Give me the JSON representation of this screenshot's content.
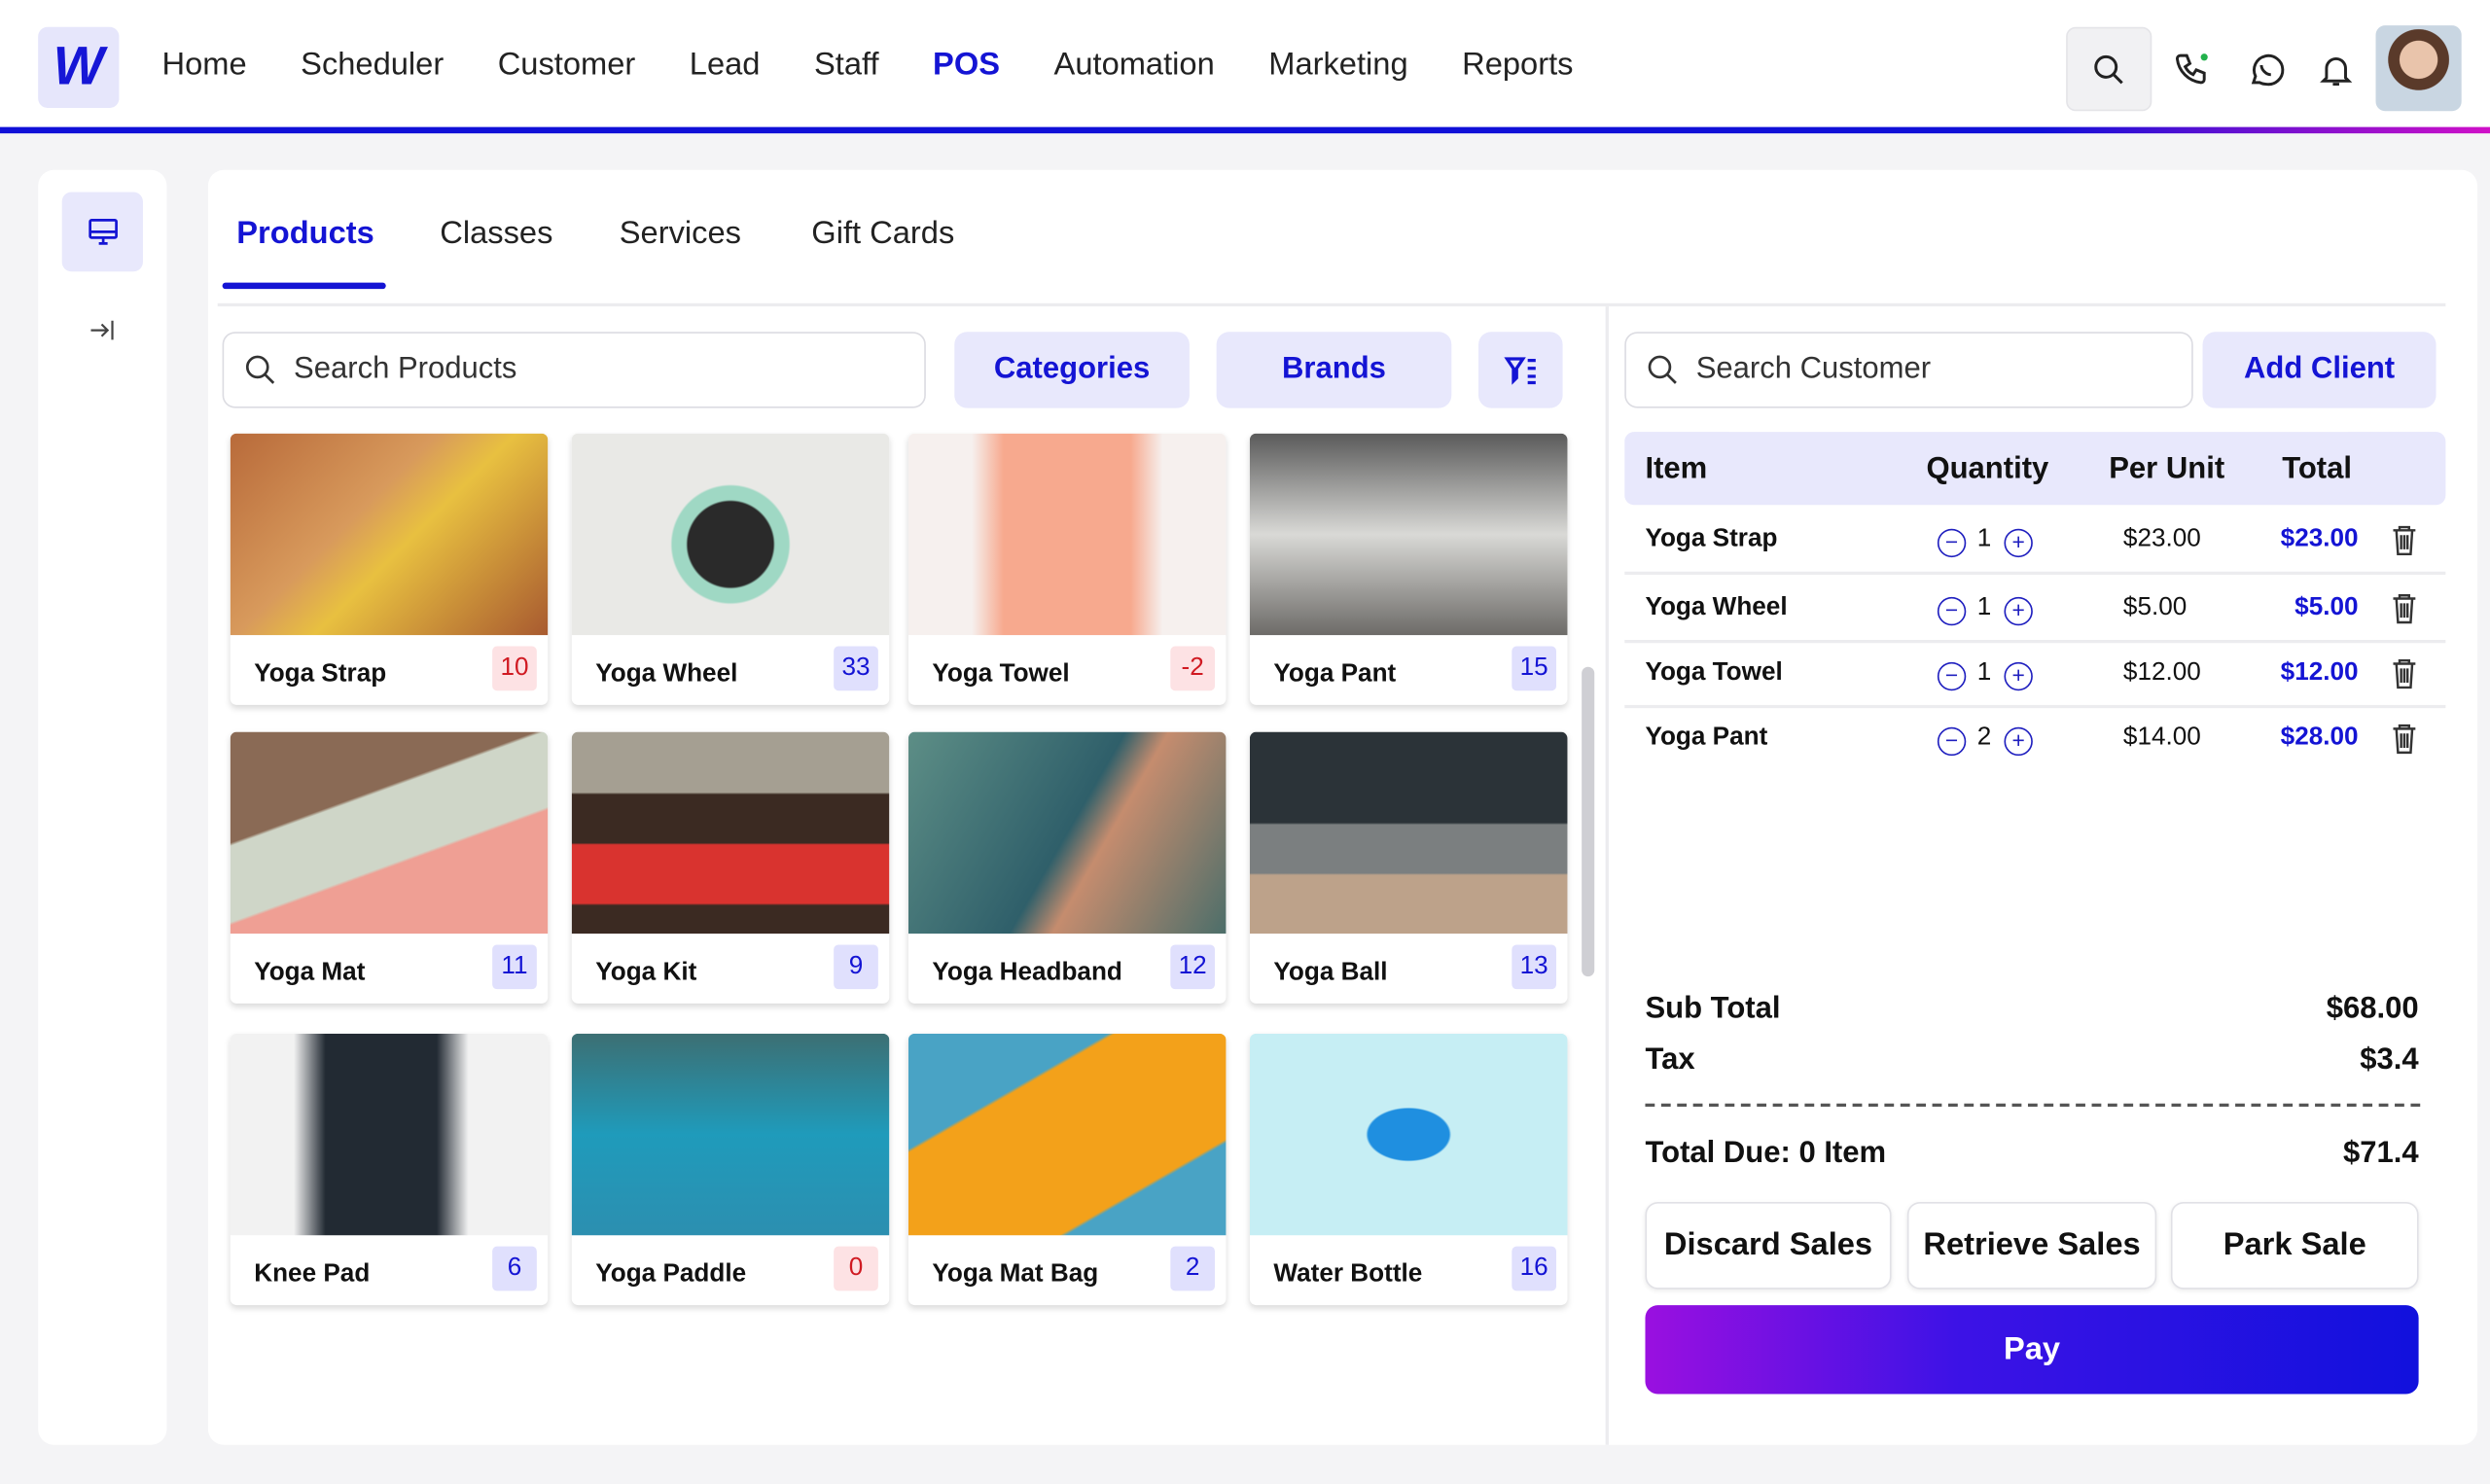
{
  "nav": {
    "logo": "W",
    "items": [
      "Home",
      "Scheduler",
      "Customer",
      "Lead",
      "Staff",
      "POS",
      "Automation",
      "Marketing",
      "Reports"
    ],
    "active": "POS"
  },
  "tabs": [
    "Products",
    "Classes",
    "Services",
    "Gift Cards"
  ],
  "search_products": {
    "placeholder": "Search Products"
  },
  "filters": {
    "categories": "Categories",
    "brands": "Brands"
  },
  "products": [
    {
      "name": "Yoga Strap",
      "stock": "10",
      "status": "low"
    },
    {
      "name": "Yoga Wheel",
      "stock": "33",
      "status": "ok"
    },
    {
      "name": "Yoga Towel",
      "stock": "-2",
      "status": "low"
    },
    {
      "name": "Yoga Pant",
      "stock": "15",
      "status": "ok"
    },
    {
      "name": "Yoga Mat",
      "stock": "11",
      "status": "ok"
    },
    {
      "name": "Yoga Kit",
      "stock": "9",
      "status": "ok"
    },
    {
      "name": "Yoga Headband",
      "stock": "12",
      "status": "ok"
    },
    {
      "name": "Yoga Ball",
      "stock": "13",
      "status": "ok"
    },
    {
      "name": "Knee Pad",
      "stock": "6",
      "status": "ok"
    },
    {
      "name": "Yoga Paddle",
      "stock": "0",
      "status": "low"
    },
    {
      "name": "Yoga Mat Bag",
      "stock": "2",
      "status": "ok"
    },
    {
      "name": "Water Bottle",
      "stock": "16",
      "status": "ok"
    }
  ],
  "customer": {
    "placeholder": "Search Customer",
    "add_client": "Add Client"
  },
  "cart": {
    "headers": {
      "item": "Item",
      "quantity": "Quantity",
      "per_unit": "Per Unit",
      "total": "Total"
    },
    "rows": [
      {
        "item": "Yoga Strap",
        "qty": "1",
        "unit": "$23.00",
        "total": "$23.00"
      },
      {
        "item": "Yoga Wheel",
        "qty": "1",
        "unit": "$5.00",
        "total": "$5.00"
      },
      {
        "item": "Yoga Towel",
        "qty": "1",
        "unit": "$12.00",
        "total": "$12.00"
      },
      {
        "item": "Yoga Pant",
        "qty": "2",
        "unit": "$14.00",
        "total": "$28.00"
      }
    ]
  },
  "summary": {
    "subtotal_label": "Sub Total",
    "subtotal": "$68.00",
    "tax_label": "Tax",
    "tax": "$3.4",
    "total_label": "Total Due: 0 Item",
    "total": "$71.4"
  },
  "actions": {
    "discard": "Discard Sales",
    "retrieve": "Retrieve Sales",
    "park": "Park Sale",
    "pay": "Pay"
  },
  "colors": {
    "accent": "#1414d4",
    "accent_bg": "#e8e8fc",
    "danger": "#d01a22"
  }
}
